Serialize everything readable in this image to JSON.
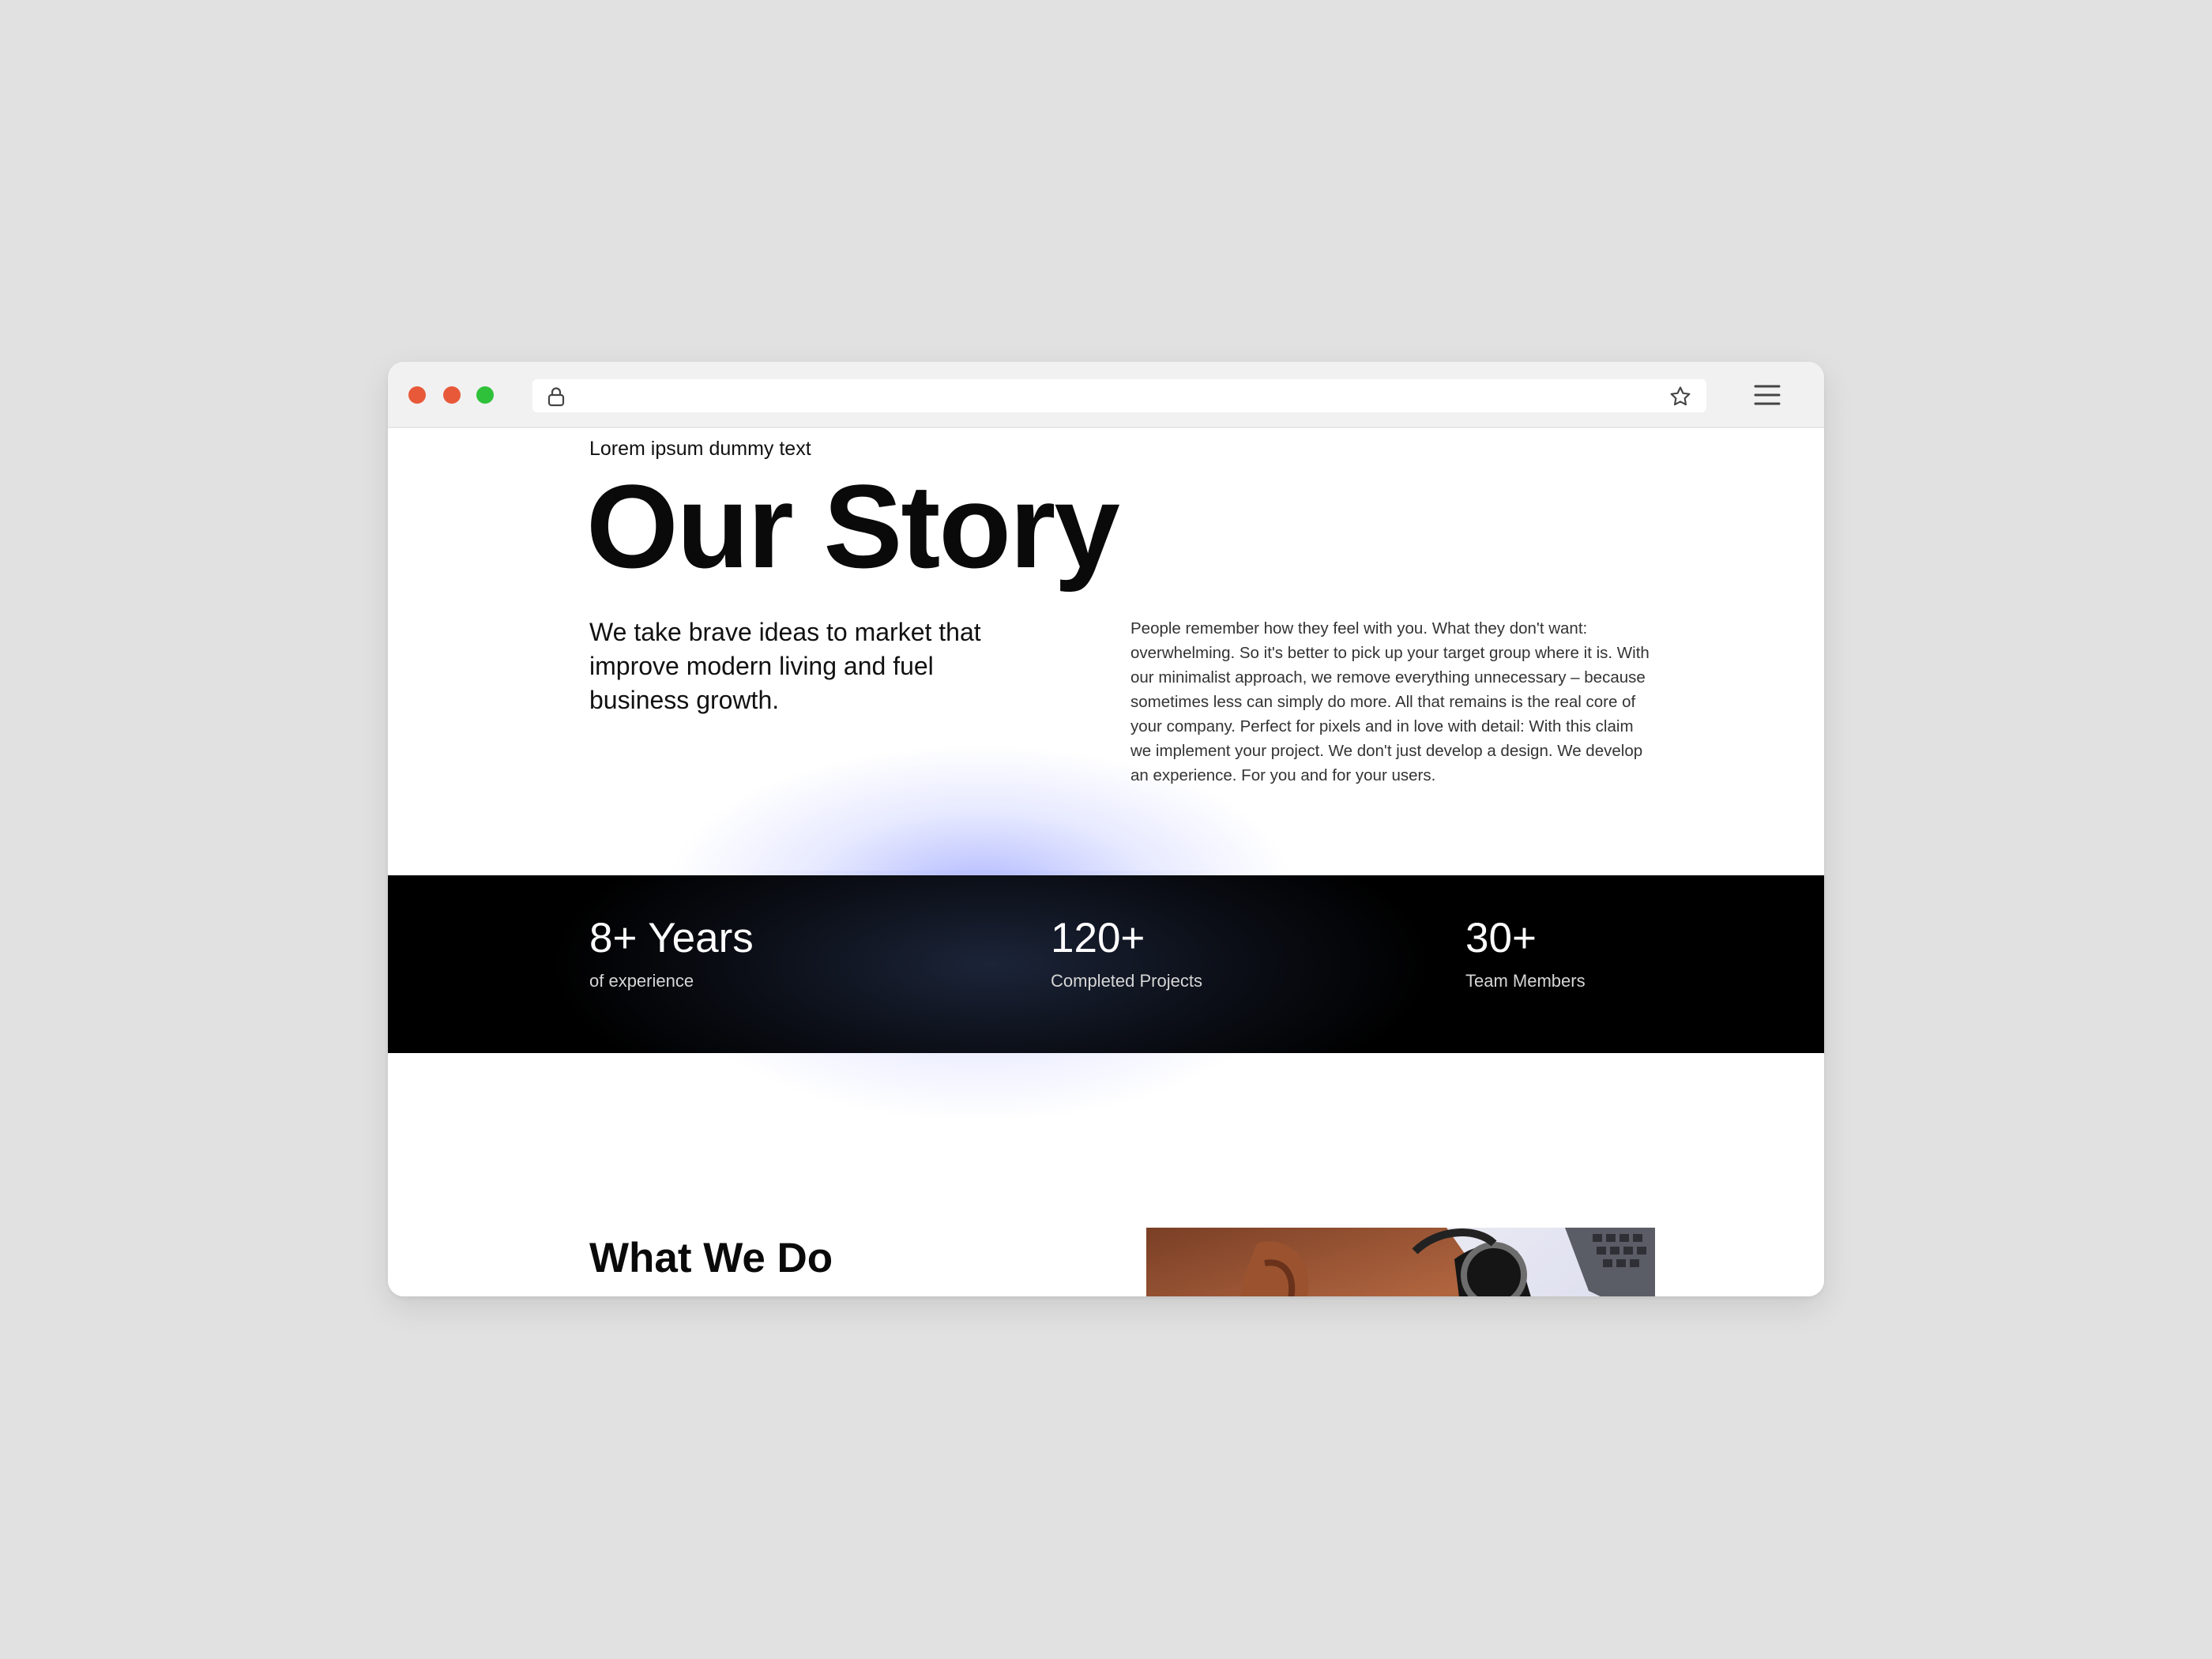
{
  "window": {
    "url": "",
    "controls": [
      "close",
      "minimize",
      "maximize"
    ],
    "icons": {
      "lock": "lock-icon",
      "bookmark": "star-icon",
      "menu": "hamburger-menu-icon"
    }
  },
  "hero": {
    "eyebrow": "Lorem ipsum dummy text",
    "title": "Our Story",
    "tagline": "We take brave ideas to market that improve modern living and fuel business growth.",
    "description": "People remember how they feel with you. What they don't want: overwhelming. So it's better to pick up your target group where it is. With our minimalist approach, we remove everything unnecessary – because sometimes less can simply do more. All that remains is the real core of your company. Perfect for pixels and in love with detail: With this claim we implement your project. We don't just develop a design. We develop an experience. For you and for your users."
  },
  "stats": [
    {
      "value": "8+ Years",
      "label": "of experience"
    },
    {
      "value": "120+",
      "label": "Completed Projects"
    },
    {
      "value": "30+",
      "label": "Team Members"
    }
  ],
  "what_we_do": {
    "title": "What We Do"
  },
  "colors": {
    "page_background": "#e1e1e1",
    "toolbar": "#f1f1f1",
    "dot_red": "#e8593a",
    "dot_green": "#2fc13a",
    "stats_band": "#000000",
    "glow": "#7684ff"
  }
}
